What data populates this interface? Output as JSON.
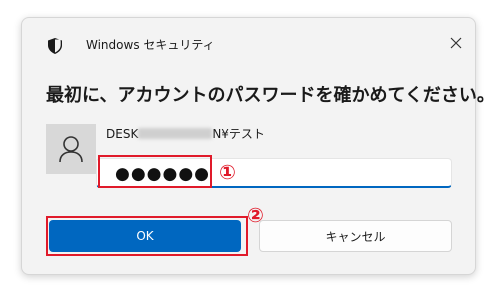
{
  "window": {
    "title": "Windows セキュリティ"
  },
  "dialog": {
    "heading": "最初に、アカウントのパスワードを確かめてください。",
    "account_prefix": "DESK",
    "account_suffix": "N¥テスト",
    "password_value": "●●●●●●"
  },
  "buttons": {
    "ok_label": "OK",
    "cancel_label": "キャンセル"
  },
  "annotations": {
    "marker_1": "①",
    "marker_2": "②",
    "highlight_color": "#e01a2a"
  },
  "colors": {
    "accent": "#0067c0",
    "dialog_bg": "#f3f3f3",
    "avatar_bg": "#d8d8d8"
  },
  "icons": {
    "title": "shield-icon",
    "close": "close-icon",
    "avatar": "user-icon"
  }
}
